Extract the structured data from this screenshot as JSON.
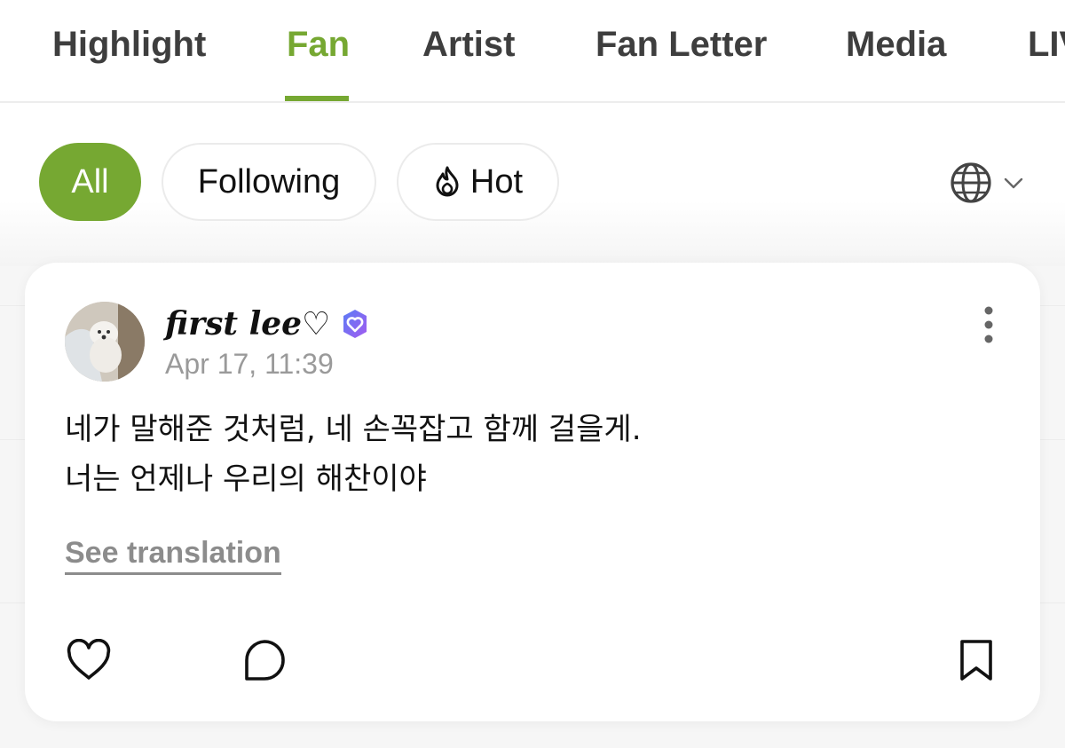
{
  "tabs": [
    {
      "label": "Highlight",
      "active": false
    },
    {
      "label": "Fan",
      "active": true
    },
    {
      "label": "Artist",
      "active": false
    },
    {
      "label": "Fan Letter",
      "active": false
    },
    {
      "label": "Media",
      "active": false
    },
    {
      "label": "LIV",
      "active": false
    }
  ],
  "filters": {
    "all_label": "All",
    "following_label": "Following",
    "hot_label": "Hot",
    "hot_icon": "flame-icon",
    "language_icon": "globe-icon"
  },
  "post": {
    "username": "first lee♡",
    "verified_icon": "verified-badge-icon",
    "timestamp": "Apr 17, 11:39",
    "body_lines": [
      "네가 말해준 것처럼, 네 손꼭잡고 함께 걸을게.",
      "너는 언제나 우리의 해찬이야"
    ],
    "see_translation": "See translation",
    "actions": [
      "heart-icon",
      "comment-icon",
      "bookmark-icon"
    ]
  },
  "colors": {
    "accent": "#76a832",
    "muted": "#9a9a9a",
    "badge_gradient": [
      "#5b7cf5",
      "#a25cf0"
    ]
  }
}
